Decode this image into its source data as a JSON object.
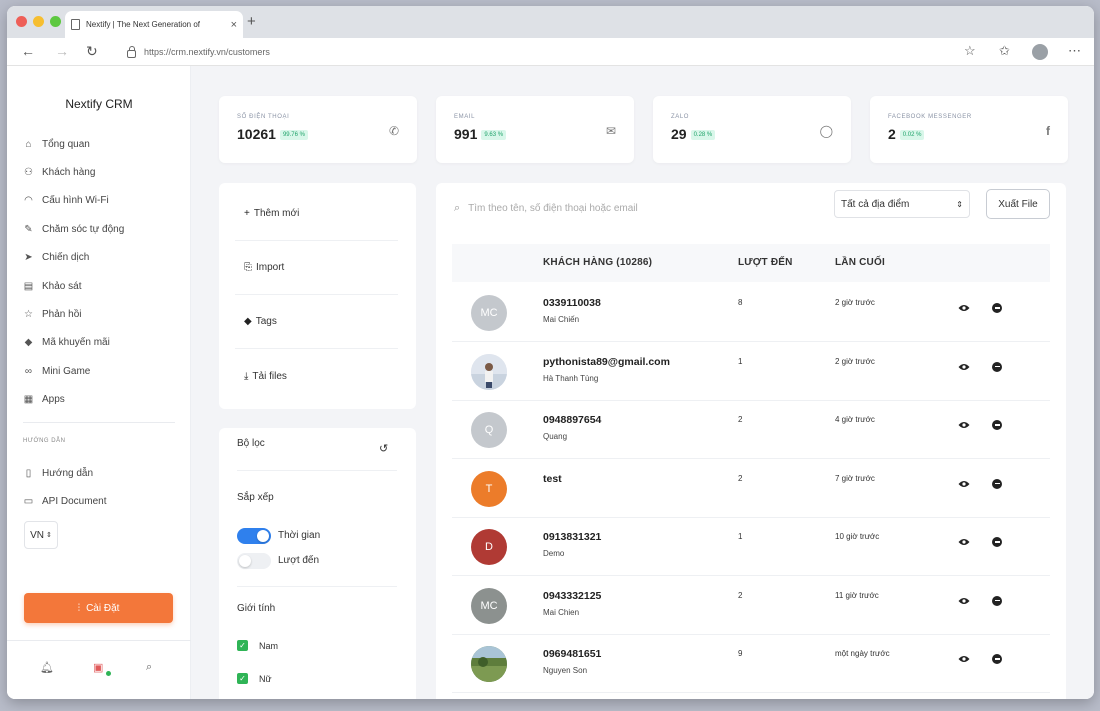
{
  "browser": {
    "tab_title": "Nextify | The Next Generation of",
    "url": "https://crm.nextify.vn/customers"
  },
  "sidebar": {
    "brand": "Nextify CRM",
    "items": [
      {
        "label": "Tổng quan",
        "icon": "home-icon"
      },
      {
        "label": "Khách hàng",
        "icon": "users-icon"
      },
      {
        "label": "Cấu hình Wi-Fi",
        "icon": "wifi-icon"
      },
      {
        "label": "Chăm sóc tự động",
        "icon": "magic-icon"
      },
      {
        "label": "Chiến dịch",
        "icon": "send-icon"
      },
      {
        "label": "Khảo sát",
        "icon": "survey-icon"
      },
      {
        "label": "Phản hồi",
        "icon": "star-icon"
      },
      {
        "label": "Mã khuyến mãi",
        "icon": "tag-icon"
      },
      {
        "label": "Mini Game",
        "icon": "gamepad-icon"
      },
      {
        "label": "Apps",
        "icon": "apps-icon"
      }
    ],
    "section_label": "HƯỚNG DẪN",
    "help_items": [
      {
        "label": "Hướng dẫn",
        "icon": "document-icon"
      },
      {
        "label": "API Document",
        "icon": "book-icon"
      }
    ],
    "language": "VN",
    "setup_button": "Cài Đặt"
  },
  "stats": [
    {
      "label": "SỐ ĐIỆN THOẠI",
      "value": "10261",
      "percent": "99.76 %",
      "icon": "phone-icon"
    },
    {
      "label": "EMAIL",
      "value": "991",
      "percent": "9.63 %",
      "icon": "mail-icon"
    },
    {
      "label": "ZALO",
      "value": "29",
      "percent": "0.28 %",
      "icon": "chat-icon"
    },
    {
      "label": "FACEBOOK MESSENGER",
      "value": "2",
      "percent": "0.02 %",
      "icon": "facebook-icon"
    }
  ],
  "actions": {
    "add_new": "Thêm mới",
    "import": "Import",
    "tags": "Tags",
    "download": "Tải files"
  },
  "filter": {
    "title": "Bộ lọc",
    "sort_label": "Sắp xếp",
    "sort_time": "Thời gian",
    "sort_visits": "Lượt đến",
    "sort_time_on": true,
    "sort_visits_on": false,
    "gender_label": "Giới tính",
    "gender_male": "Nam",
    "gender_female": "Nữ"
  },
  "main": {
    "search_placeholder": "Tìm theo tên, số điện thoại hoặc email",
    "location": "Tất cả địa điểm",
    "export": "Xuất File",
    "columns": {
      "customer": "KHÁCH HÀNG (10286)",
      "visits": "LƯỢT ĐẾN",
      "last": "LẦN CUỐI"
    }
  },
  "customers": [
    {
      "initials": "MC",
      "avatar_color": "#c4c8cd",
      "name": "0339110038",
      "sub": "Mai Chiến",
      "visits": "8",
      "last": "2 giờ trước"
    },
    {
      "initials": "",
      "avatar_color": "#dfe5ee",
      "avatar_kind": "photo-person",
      "name": "pythonista89@gmail.com",
      "sub": "Hà Thanh Tùng",
      "visits": "1",
      "last": "2 giờ trước"
    },
    {
      "initials": "Q",
      "avatar_color": "#c4c8cd",
      "name": "0948897654",
      "sub": "Quang",
      "visits": "2",
      "last": "4 giờ trước"
    },
    {
      "initials": "T",
      "avatar_color": "#ec7c2a",
      "name": "test",
      "sub": "",
      "visits": "2",
      "last": "7 giờ trước"
    },
    {
      "initials": "D",
      "avatar_color": "#b03a34",
      "name": "0913831321",
      "sub": "Demo",
      "visits": "1",
      "last": "10 giờ trước"
    },
    {
      "initials": "MC",
      "avatar_color": "#8c918f",
      "name": "0943332125",
      "sub": "Mai Chien",
      "visits": "2",
      "last": "11 giờ trước"
    },
    {
      "initials": "",
      "avatar_color": "#6f8f4e",
      "avatar_kind": "photo-landscape",
      "name": "0969481651",
      "sub": "Nguyen Son",
      "visits": "9",
      "last": "một ngày trước"
    }
  ]
}
